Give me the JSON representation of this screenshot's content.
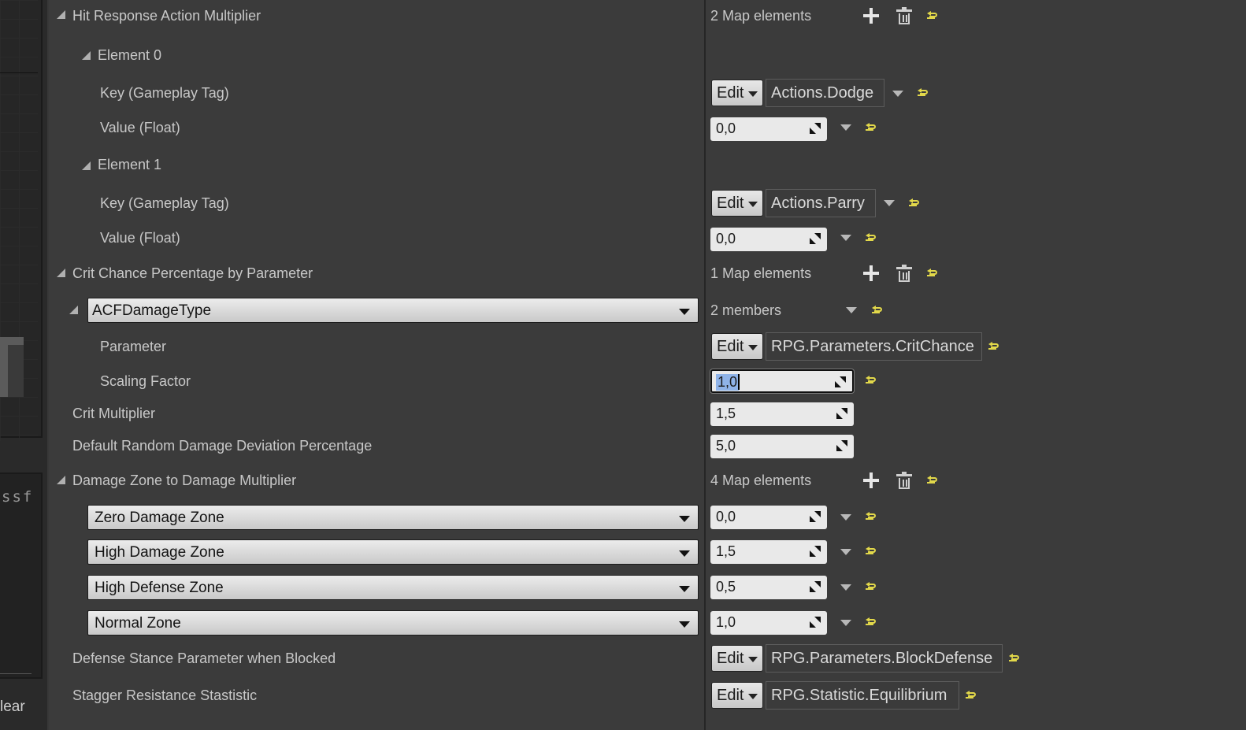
{
  "left_panel": {
    "code_text": "ssf",
    "clear_text": "lear"
  },
  "rows": {
    "hit_response": {
      "label": "Hit Response Action Multiplier",
      "count": "2 Map elements"
    },
    "element0": {
      "label": "Element 0",
      "key_label": "Key (Gameplay Tag)",
      "key_value": "Actions.Dodge",
      "value_label": "Value (Float)",
      "value": "0,0"
    },
    "element1": {
      "label": "Element 1",
      "key_label": "Key (Gameplay Tag)",
      "key_value": "Actions.Parry",
      "value_label": "Value (Float)",
      "value": "0,0"
    },
    "crit_chance": {
      "label": "Crit Chance Percentage by Parameter",
      "count": "1 Map elements"
    },
    "acf": {
      "combo": "ACFDamageType",
      "members": "2 members"
    },
    "parameter": {
      "label": "Parameter",
      "value": "RPG.Parameters.CritChance"
    },
    "scaling": {
      "label": "Scaling Factor",
      "value": "1,0"
    },
    "crit_mult": {
      "label": "Crit Multiplier",
      "value": "1,5"
    },
    "deviation": {
      "label": "Default Random Damage Deviation Percentage",
      "value": "5,0"
    },
    "damage_zone": {
      "label": "Damage Zone to Damage Multiplier",
      "count": "4 Map elements"
    },
    "zones": [
      {
        "name": "Zero Damage Zone",
        "value": "0,0"
      },
      {
        "name": "High Damage Zone",
        "value": "1,5"
      },
      {
        "name": "High Defense Zone",
        "value": "0,5"
      },
      {
        "name": "Normal Zone",
        "value": "1,0"
      }
    ],
    "defense_stance": {
      "label": "Defense Stance Parameter when Blocked",
      "value": "RPG.Parameters.BlockDefense"
    },
    "stagger": {
      "label": "Stagger Resistance Stastistic",
      "value": "RPG.Statistic.Equilibrium"
    }
  },
  "common": {
    "edit_label": "Edit"
  },
  "colors": {
    "reset_icon": "#e2d84a",
    "selection": "#8fb3e8",
    "panel_bg": "#3b3b3b"
  }
}
